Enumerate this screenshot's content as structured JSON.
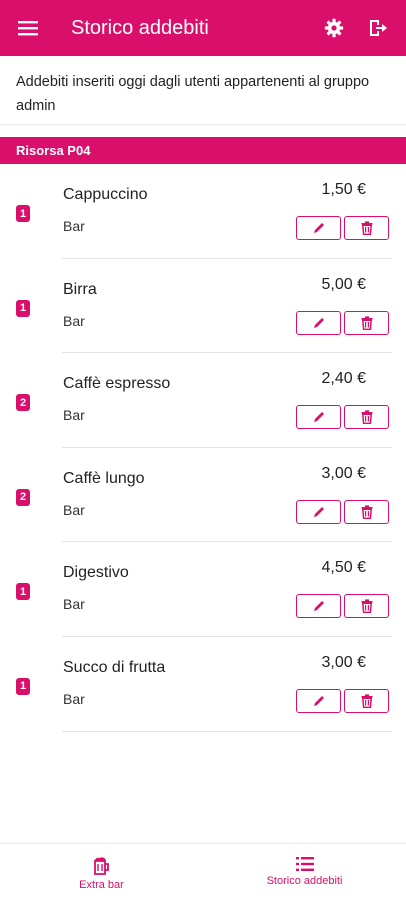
{
  "header": {
    "title": "Storico addebiti",
    "menu_icon": "menu-icon",
    "settings_icon": "gear-icon",
    "logout_icon": "logout-icon"
  },
  "subtitle": "Addebiti inseriti oggi dagli utenti appartenenti al gruppo admin",
  "section": {
    "title": "Risorsa P04"
  },
  "items": [
    {
      "qty": "1",
      "name": "Cappuccino",
      "category": "Bar",
      "price": "1,50 €"
    },
    {
      "qty": "1",
      "name": "Birra",
      "category": "Bar",
      "price": "5,00 €"
    },
    {
      "qty": "2",
      "name": "Caffè espresso",
      "category": "Bar",
      "price": "2,40 €"
    },
    {
      "qty": "2",
      "name": "Caffè lungo",
      "category": "Bar",
      "price": "3,00 €"
    },
    {
      "qty": "1",
      "name": "Digestivo",
      "category": "Bar",
      "price": "4,50 €"
    },
    {
      "qty": "1",
      "name": "Succo di frutta",
      "category": "Bar",
      "price": "3,00 €"
    }
  ],
  "bottom_nav": {
    "extra_bar": "Extra bar",
    "storico": "Storico addebiti"
  },
  "colors": {
    "accent": "#d90f6b"
  }
}
